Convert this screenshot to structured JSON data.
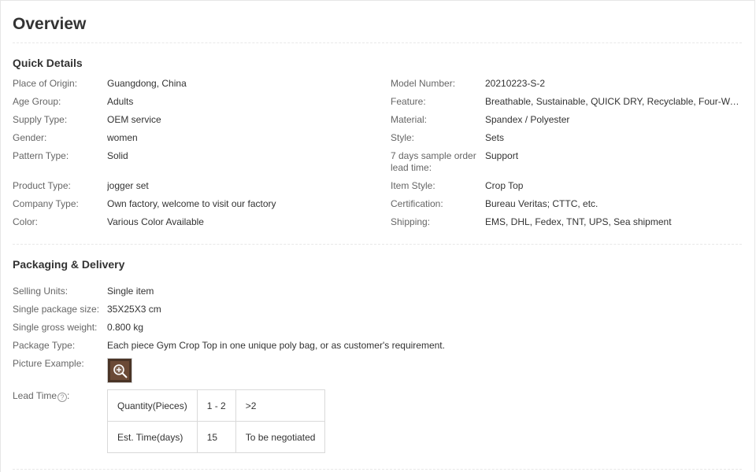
{
  "title": "Overview",
  "quick_details": {
    "heading": "Quick Details",
    "left": [
      {
        "label": "Place of Origin:",
        "value": "Guangdong, China"
      },
      {
        "label": "Age Group:",
        "value": "Adults"
      },
      {
        "label": "Supply Type:",
        "value": "OEM service"
      },
      {
        "label": "Gender:",
        "value": "women"
      },
      {
        "label": "Pattern Type:",
        "value": "Solid"
      },
      {
        "label": "Product Type:",
        "value": "jogger set"
      },
      {
        "label": "Company Type:",
        "value": "Own factory, welcome to visit our factory"
      },
      {
        "label": "Color:",
        "value": "Various Color Available"
      }
    ],
    "right": [
      {
        "label": "Model Number:",
        "value": "20210223-S-2"
      },
      {
        "label": "Feature:",
        "value": "Breathable, Sustainable, QUICK DRY, Recyclable, Four-Way Stretch"
      },
      {
        "label": "Material:",
        "value": "Spandex / Polyester"
      },
      {
        "label": "Style:",
        "value": "Sets"
      },
      {
        "label": "7 days sample order lead time:",
        "value": "Support"
      },
      {
        "label": "Item Style:",
        "value": "Crop Top"
      },
      {
        "label": "Certification:",
        "value": "Bureau Veritas; CTTC, etc."
      },
      {
        "label": "Shipping:",
        "value": "EMS, DHL, Fedex, TNT, UPS, Sea shipment"
      }
    ]
  },
  "packaging": {
    "heading": "Packaging & Delivery",
    "rows": [
      {
        "label": "Selling Units:",
        "value": "Single item"
      },
      {
        "label": "Single package size:",
        "value": "35X25X3 cm"
      },
      {
        "label": "Single gross weight:",
        "value": "0.800 kg"
      },
      {
        "label": "Package Type:",
        "value": "Each piece Gym Crop Top in one unique poly bag, or as customer's requirement."
      },
      {
        "label": "Picture Example:",
        "value": ""
      }
    ],
    "lead_time": {
      "label": "Lead Time",
      "help_glyph": "?",
      "colon": ":",
      "rows": [
        [
          "Quantity(Pieces)",
          "1 - 2",
          ">2"
        ],
        [
          "Est. Time(days)",
          "15",
          "To be negotiated"
        ]
      ]
    }
  }
}
